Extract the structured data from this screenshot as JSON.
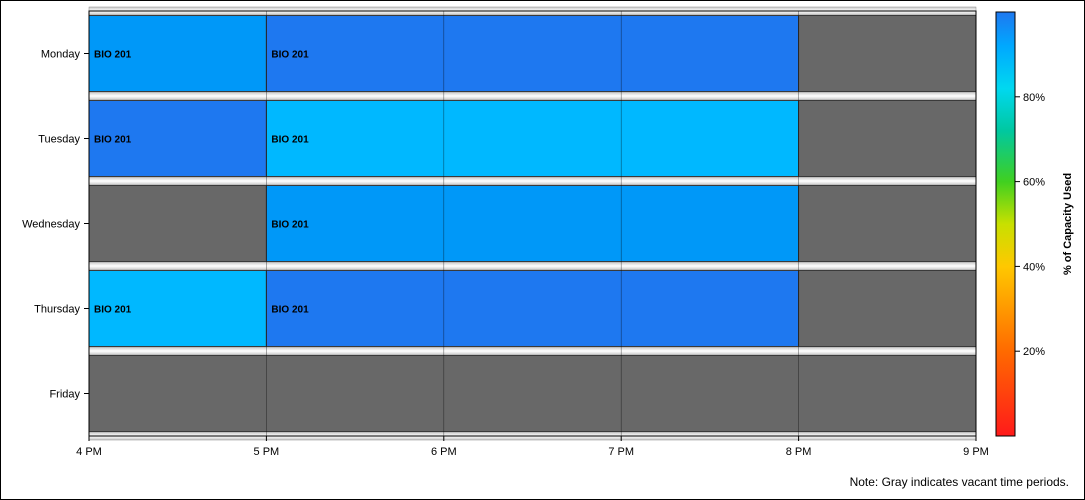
{
  "chart_data": {
    "type": "heatmap",
    "subtype": "schedule-timeline",
    "days": [
      "Monday",
      "Tuesday",
      "Wednesday",
      "Thursday",
      "Friday"
    ],
    "x_ticks": [
      {
        "value": 16,
        "label": "4 PM"
      },
      {
        "value": 17,
        "label": "5 PM"
      },
      {
        "value": 18,
        "label": "6 PM"
      },
      {
        "value": 19,
        "label": "7 PM"
      },
      {
        "value": 20,
        "label": "8 PM"
      },
      {
        "value": 21,
        "label": "9 PM"
      }
    ],
    "xlim": [
      16,
      21
    ],
    "blocks": [
      {
        "day": "Monday",
        "start": 16,
        "end": 17,
        "label": "BIO 201",
        "capacity_pct": 95
      },
      {
        "day": "Monday",
        "start": 17,
        "end": 20,
        "label": "BIO 201",
        "capacity_pct": 100
      },
      {
        "day": "Monday",
        "start": 20,
        "end": 21,
        "label": "",
        "capacity_pct": null
      },
      {
        "day": "Tuesday",
        "start": 16,
        "end": 17,
        "label": "BIO 201",
        "capacity_pct": 100
      },
      {
        "day": "Tuesday",
        "start": 17,
        "end": 20,
        "label": "BIO 201",
        "capacity_pct": 90
      },
      {
        "day": "Tuesday",
        "start": 20,
        "end": 21,
        "label": "",
        "capacity_pct": null
      },
      {
        "day": "Wednesday",
        "start": 16,
        "end": 17,
        "label": "",
        "capacity_pct": null
      },
      {
        "day": "Wednesday",
        "start": 17,
        "end": 20,
        "label": "BIO 201",
        "capacity_pct": 95
      },
      {
        "day": "Wednesday",
        "start": 20,
        "end": 21,
        "label": "",
        "capacity_pct": null
      },
      {
        "day": "Thursday",
        "start": 16,
        "end": 17,
        "label": "BIO 201",
        "capacity_pct": 90
      },
      {
        "day": "Thursday",
        "start": 17,
        "end": 20,
        "label": "BIO 201",
        "capacity_pct": 100
      },
      {
        "day": "Thursday",
        "start": 20,
        "end": 21,
        "label": "",
        "capacity_pct": null
      },
      {
        "day": "Friday",
        "start": 16,
        "end": 21,
        "label": "",
        "capacity_pct": null
      }
    ],
    "legend": {
      "title": "% of Capacity Used",
      "range": [
        0,
        100
      ],
      "ticks": [
        {
          "value": 20,
          "label": "20%"
        },
        {
          "value": 40,
          "label": "40%"
        },
        {
          "value": 60,
          "label": "60%"
        },
        {
          "value": 80,
          "label": "80%"
        }
      ],
      "placement": "right"
    },
    "vacant_color": "#686868",
    "note": "Note: Gray indicates vacant time periods."
  }
}
